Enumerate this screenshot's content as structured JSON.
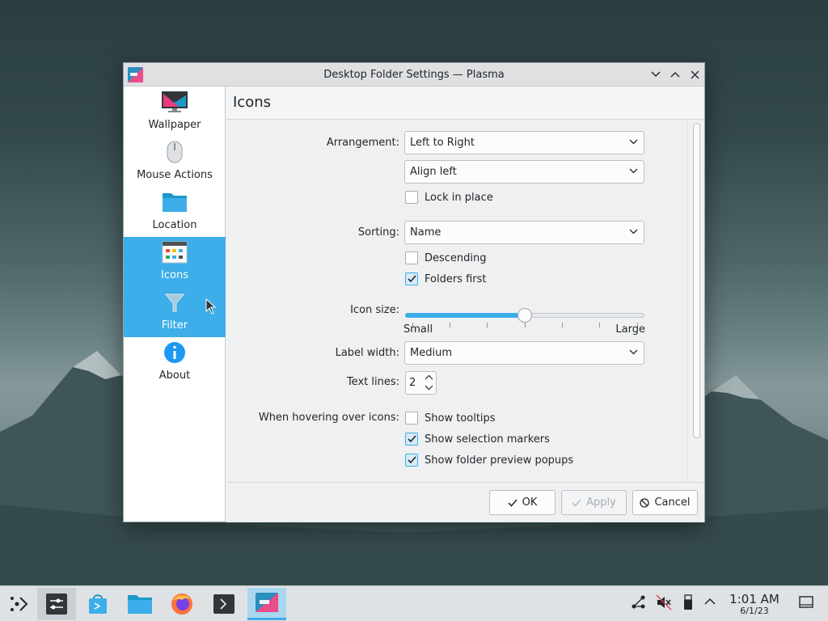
{
  "window": {
    "title": "Desktop Folder Settings — Plasma"
  },
  "sidebar": {
    "items": [
      {
        "label": "Wallpaper",
        "icon": "monitor-icon"
      },
      {
        "label": "Mouse Actions",
        "icon": "mouse-icon"
      },
      {
        "label": "Location",
        "icon": "folder-icon"
      },
      {
        "label": "Icons",
        "icon": "icons-view-icon",
        "active": true
      },
      {
        "label": "Filter",
        "icon": "filter-funnel-icon",
        "active": true
      },
      {
        "label": "About",
        "icon": "info-icon"
      }
    ]
  },
  "page": {
    "heading": "Icons"
  },
  "form": {
    "arrangement_label": "Arrangement:",
    "arrangement_value": "Left to Right",
    "alignment_value": "Align left",
    "lock_label": "Lock in place",
    "lock_checked": false,
    "sorting_label": "Sorting:",
    "sorting_value": "Name",
    "descending_label": "Descending",
    "descending_checked": false,
    "folders_first_label": "Folders first",
    "folders_first_checked": true,
    "icon_size_label": "Icon size:",
    "icon_size_min_label": "Small",
    "icon_size_max_label": "Large",
    "icon_size_level": 0.5,
    "label_width_label": "Label width:",
    "label_width_value": "Medium",
    "text_lines_label": "Text lines:",
    "text_lines_value": "2",
    "hover_label": "When hovering over icons:",
    "tooltips_label": "Show tooltips",
    "tooltips_checked": false,
    "selection_markers_label": "Show selection markers",
    "selection_markers_checked": true,
    "folder_preview_label": "Show folder preview popups",
    "folder_preview_checked": true
  },
  "footer": {
    "ok_label": "OK",
    "apply_label": "Apply",
    "cancel_label": "Cancel"
  },
  "taskbar": {
    "items": [
      "application-launcher-icon",
      "system-settings-icon",
      "discover-store-icon",
      "dolphin-folder-icon",
      "firefox-icon",
      "konsole-terminal-icon",
      "plasma-settings-icon"
    ],
    "clock_time": "1:01 AM",
    "clock_date": "6/1/23"
  },
  "colors": {
    "accent": "#3daee9",
    "window_bg": "#eff0f1",
    "text": "#232629"
  }
}
